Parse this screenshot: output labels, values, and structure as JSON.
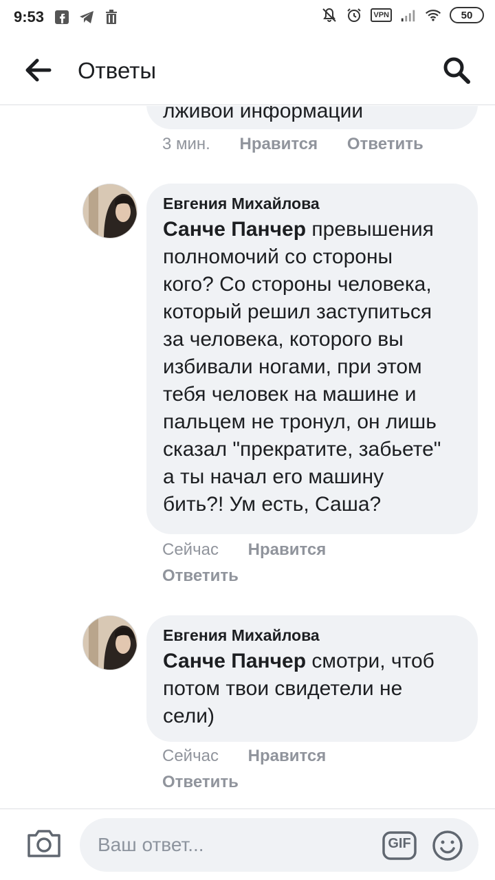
{
  "status_bar": {
    "time": "9:53",
    "vpn": "VPN",
    "battery": "50"
  },
  "header": {
    "title": "Ответы"
  },
  "comments": [
    {
      "text": "лживой информации",
      "time": "3 мин.",
      "like": "Нравится",
      "reply": "Ответить"
    },
    {
      "author": "Евгения Михайлова",
      "mention": "Санче Панчер",
      "line1_rest": " превышения",
      "lines": [
        "полномочий со стороны",
        "кого? Со стороны человека,",
        "который решил заступиться",
        "за человека, которого вы",
        "избивали ногами, при этом",
        "тебя человек на машине и",
        "пальцем не тронул, он лишь",
        "сказал \"прекратите, забьете\"",
        "а ты начал его машину",
        "бить?! Ум есть, Саша?"
      ],
      "time": "Сейчас",
      "like": "Нравится",
      "reply": "Ответить"
    },
    {
      "author": "Евгения Михайлова",
      "mention": "Санче Панчер",
      "line1_rest": " смотри, чтоб",
      "lines": [
        "потом твои свидетели не",
        "сели)"
      ],
      "time": "Сейчас",
      "like": "Нравится",
      "reply": "Ответить"
    }
  ],
  "composer": {
    "placeholder": "Ваш ответ...",
    "gif_label": "GIF"
  }
}
